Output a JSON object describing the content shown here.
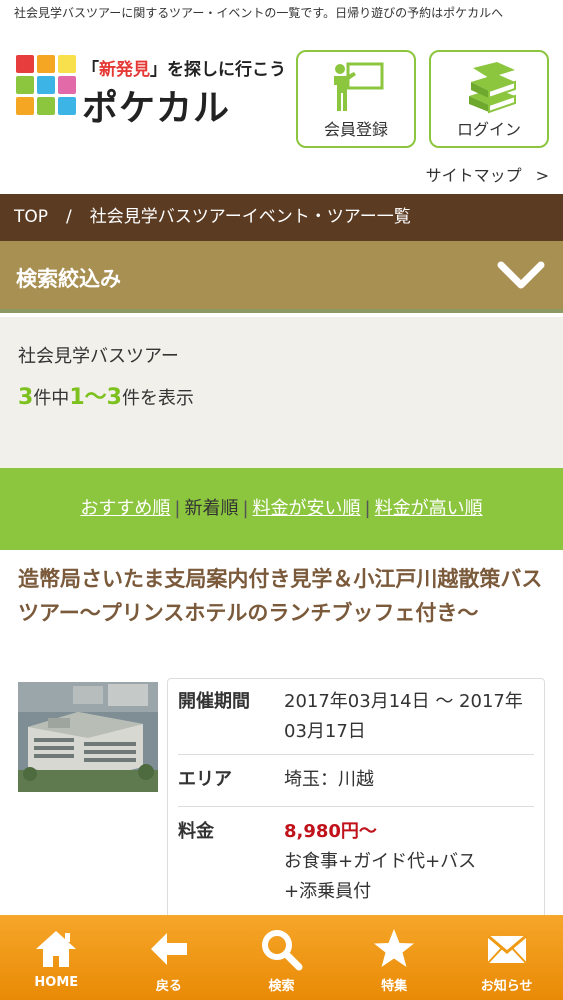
{
  "header": {
    "tagline": "社会見学バスツアーに関するツアー・イベントの一覧です。日帰り遊びの予約はポケカルへ",
    "logo": {
      "slogan_open": "「",
      "slogan_highlight": "新発見",
      "slogan_rest": "」を探しに行こう",
      "name": "ポケカル",
      "colors": [
        "#e83d3d",
        "#f5a623",
        "#f7e04b",
        "#8cc63f",
        "#3cb4e5",
        "#e26aa8",
        "#f5a623",
        "#8cc63f",
        "#3cb4e5"
      ]
    },
    "member_button": {
      "label": "会員登録",
      "icon": "member-register-icon"
    },
    "login_button": {
      "label": "ログイン",
      "icon": "books-icon"
    },
    "sitemap": {
      "label": "サイトマップ",
      "arrow": ">"
    }
  },
  "breadcrumb": {
    "home": "TOP",
    "separator": "/",
    "current": "社会見学バスツアーイベント・ツアー一覧"
  },
  "filter": {
    "title": "検索絞込み",
    "icon": "chevron-down-icon"
  },
  "results": {
    "category": "社会見学バスツアー",
    "total": "3",
    "total_suffix": "件中",
    "range": "1〜3",
    "range_suffix": "件を表示"
  },
  "sort": {
    "options": [
      "おすすめ順",
      "新着順",
      "料金が安い順",
      "料金が高い順"
    ],
    "separator": "|"
  },
  "tour": {
    "title": "造幣局さいたま支局案内付き見学＆小江戸川越散策バスツアー〜プリンスホテルのランチブッフェ付き〜",
    "period_label": "開催期間",
    "period_value": "2017年03月14日 〜 2017年03月17日",
    "area_label": "エリア",
    "area_value": "埼玉：川越",
    "price_label": "料金",
    "price_value": "8,980円〜",
    "price_note": "お食事+ガイド代+バス+添乗員付"
  },
  "bottom_nav": [
    {
      "label": "HOME",
      "icon": "home-icon"
    },
    {
      "label": "戻る",
      "icon": "back-arrow-icon"
    },
    {
      "label": "検索",
      "icon": "search-icon"
    },
    {
      "label": "特集",
      "icon": "star-icon"
    },
    {
      "label": "お知らせ",
      "icon": "mail-icon"
    }
  ],
  "colors": {
    "brand_green": "#8cc63f",
    "breadcrumb_brown": "#5b3b22",
    "filter_tan": "#a88f52",
    "title_brown": "#7a5a3a",
    "price_red": "#c0121b",
    "nav_orange": "#f09a14"
  }
}
